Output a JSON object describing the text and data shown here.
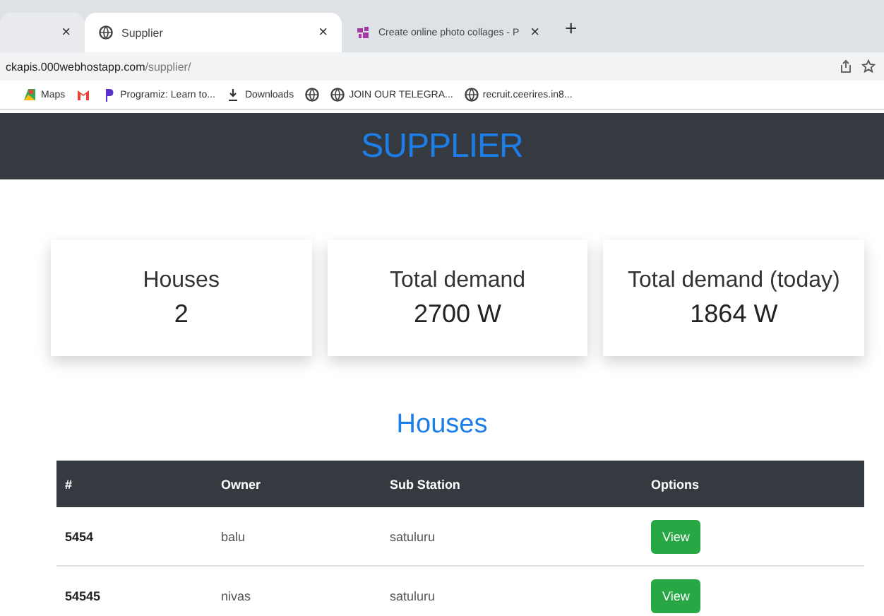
{
  "browser": {
    "tabs": [
      {
        "close": "×",
        "selected": false
      },
      {
        "title": "Supplier",
        "close": "×",
        "selected": true
      },
      {
        "title": "Create online photo collages - P",
        "close": "×",
        "selected": false
      }
    ],
    "new_tab": "+",
    "address": {
      "host": "ckapis.000webhostapp.com",
      "path": "/supplier/"
    },
    "bookmarks": [
      {
        "kind": "maps",
        "label": "Maps"
      },
      {
        "kind": "gmail"
      },
      {
        "kind": "programiz",
        "label": "Programiz: Learn to..."
      },
      {
        "kind": "download",
        "label": "Downloads"
      },
      {
        "kind": "globe"
      },
      {
        "kind": "globe",
        "label": "JOIN OUR TELEGRA..."
      },
      {
        "kind": "globe",
        "label": "recruit.ceerires.in8..."
      }
    ]
  },
  "header": {
    "title": "SUPPLIER"
  },
  "stats": [
    {
      "label": "Houses",
      "value": "2"
    },
    {
      "label": "Total demand",
      "value": "2700 W"
    },
    {
      "label": "Total demand (today)",
      "value": "1864 W"
    }
  ],
  "houses": {
    "title": "Houses",
    "columns": [
      "#",
      "Owner",
      "Sub Station",
      "Options"
    ],
    "rows": [
      {
        "id": "5454",
        "owner": "balu",
        "substation": "satuluru",
        "action": "View"
      },
      {
        "id": "54545",
        "owner": "nivas",
        "substation": "satuluru",
        "action": "View"
      }
    ]
  }
}
